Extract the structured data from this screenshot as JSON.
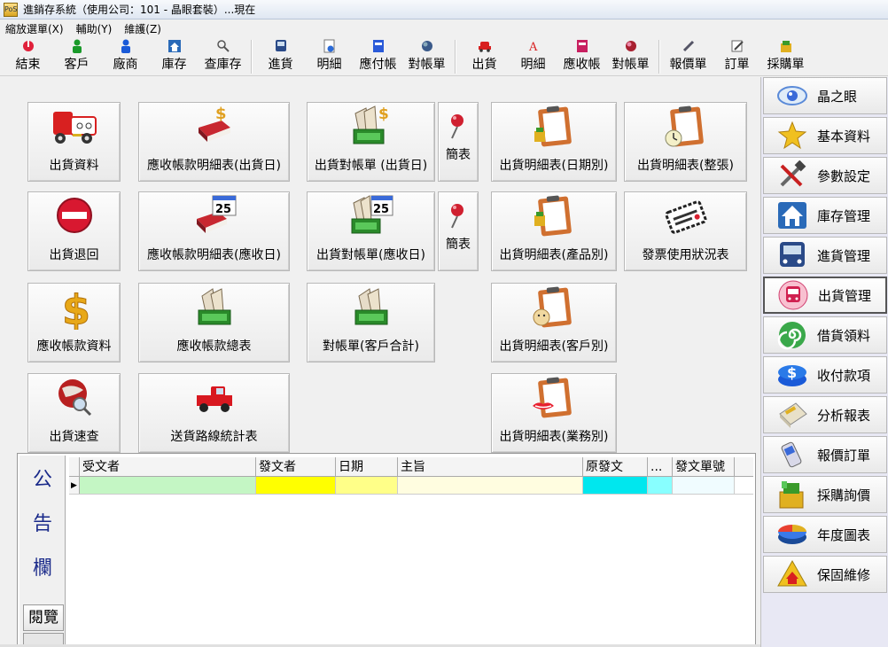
{
  "window": {
    "title": "進銷存系統（使用公司：101 - 晶眼套裝）...現在",
    "icon_text": "PoS"
  },
  "menu": [
    "縮放選單(X)",
    "輔助(Y)",
    "維護(Z)"
  ],
  "toolbar": {
    "group1": [
      {
        "label": "結束",
        "icon": "power-icon"
      },
      {
        "label": "客戶",
        "icon": "person-green-icon"
      },
      {
        "label": "廠商",
        "icon": "person-blue-icon"
      },
      {
        "label": "庫存",
        "icon": "house-icon"
      },
      {
        "label": "查庫存",
        "icon": "magnifier-icon"
      }
    ],
    "group2": [
      {
        "label": "進貨",
        "icon": "bus-icon"
      },
      {
        "label": "明細",
        "icon": "doc-plus-icon"
      },
      {
        "label": "應付帳",
        "icon": "card-blue-icon"
      },
      {
        "label": "對帳單",
        "icon": "globe-icon"
      }
    ],
    "group3": [
      {
        "label": "出貨",
        "icon": "car-red-icon"
      },
      {
        "label": "明細",
        "icon": "doc-a-icon"
      },
      {
        "label": "應收帳",
        "icon": "card-pink-icon"
      },
      {
        "label": "對帳單",
        "icon": "globe-red-icon"
      }
    ],
    "group4": [
      {
        "label": "報價單",
        "icon": "pen-icon"
      },
      {
        "label": "訂單",
        "icon": "edit-icon"
      },
      {
        "label": "採購單",
        "icon": "bag-icon"
      }
    ]
  },
  "tiles": {
    "ship_data": "出貨資料",
    "ar_detail_ship": "應收帳款明細表(出貨日)",
    "statement_ship": "出貨對帳單 (出貨日)",
    "brief1": "簡表",
    "ship_detail_date": "出貨明細表(日期別)",
    "ship_detail_full": "出貨明細表(整張)",
    "ship_return": "出貨退回",
    "ar_detail_due": "應收帳款明細表(應收日)",
    "statement_due": "出貨對帳單(應收日)",
    "brief2": "簡表",
    "ship_detail_product": "出貨明細表(產品別)",
    "invoice_usage": "發票使用狀況表",
    "ar_data": "應收帳款資料",
    "ar_summary": "應收帳款總表",
    "statement_customer": "對帳單(客戶合計)",
    "ship_detail_customer": "出貨明細表(客戶別)",
    "ship_query": "出貨速查",
    "delivery_route": "送貨路線統計表",
    "ship_detail_sales": "出貨明細表(業務別)",
    "calendar_day": "25",
    "calendar_day2": "25"
  },
  "board": {
    "title_chars": [
      "公",
      "告",
      "欄"
    ],
    "browse_label": "閱覽",
    "columns": [
      "受文者",
      "發文者",
      "日期",
      "主旨",
      "原發文",
      "...",
      "發文單號"
    ],
    "row_colors": [
      "#c4f6c4",
      "#ffff00",
      "#ffff88",
      "#fffde0",
      "#00e7ee",
      "#88ffff",
      "#f0fcff"
    ]
  },
  "nav": [
    {
      "label": "晶之眼",
      "icon": "eye-icon"
    },
    {
      "label": "基本資料",
      "icon": "star-icon"
    },
    {
      "label": "參數設定",
      "icon": "tools-icon"
    },
    {
      "label": "庫存管理",
      "icon": "house-icon"
    },
    {
      "label": "進貨管理",
      "icon": "bus-icon"
    },
    {
      "label": "出貨管理",
      "icon": "train-icon",
      "active": true
    },
    {
      "label": "借貨領料",
      "icon": "spiral-icon"
    },
    {
      "label": "收付款項",
      "icon": "dollar-icon"
    },
    {
      "label": "分析報表",
      "icon": "paper-icon"
    },
    {
      "label": "報價訂單",
      "icon": "phone-icon"
    },
    {
      "label": "採購詢價",
      "icon": "bag-icon"
    },
    {
      "label": "年度圖表",
      "icon": "pie-icon"
    },
    {
      "label": "保固維修",
      "icon": "house-warning-icon"
    }
  ]
}
